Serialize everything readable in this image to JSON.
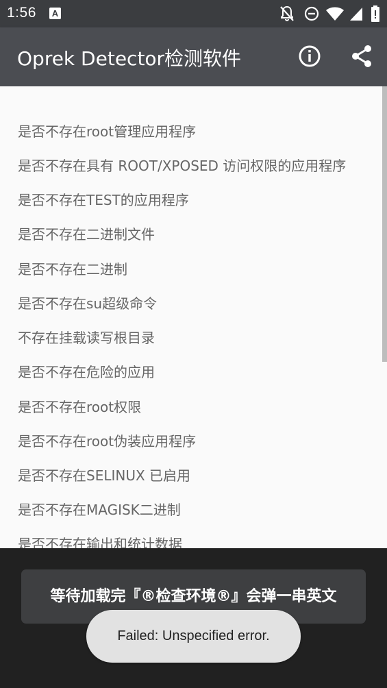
{
  "status_bar": {
    "time": "1:56",
    "notification_icon_letter": "A",
    "icons": [
      "notification-off-icon",
      "do-not-disturb-icon",
      "wifi-icon",
      "signal-icon",
      "battery-icon"
    ]
  },
  "toolbar": {
    "title": "Oprek Detector检测软件",
    "icons": [
      "info-icon",
      "share-icon"
    ]
  },
  "checks": [
    "是否不存在root管理应用程序",
    "是否不存在具有 ROOT/XPOSED 访问权限的应用程序",
    "是否不存在TEST的应用程序",
    "是否不存在二进制文件",
    "是否不存在二进制",
    "是否不存在su超级命令",
    "不存在挂载读写根目录",
    "是否不存在危险的应用",
    "是否不存在root权限",
    "是否不存在root伪装应用程序",
    "是否不存在SELINUX 已启用",
    "是否不存在MAGISK二进制",
    "是否不存在输出和统计数据"
  ],
  "banner": {
    "text": "等待加载完『®检查环境®』会弹一串英文"
  },
  "toast": {
    "text": "Failed: Unspecified error."
  },
  "colors": {
    "status_bar": "#3b3d40",
    "toolbar": "#4b4d52",
    "list_text": "#666666",
    "bottom_panel": "#212121",
    "banner": "#3e3f41",
    "toast": "#e2e2e2"
  }
}
